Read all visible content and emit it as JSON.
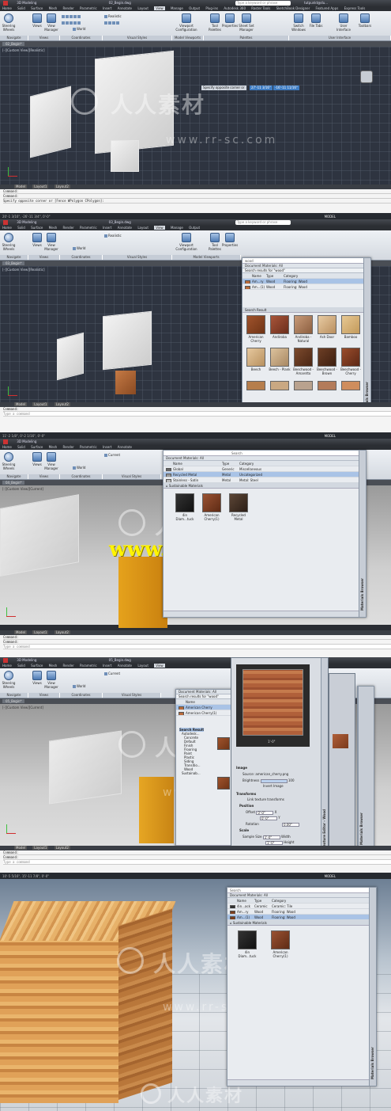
{
  "app": {
    "title_frame1": "02_Begin.dwg",
    "title_frame2": "03_Begin.dwg",
    "title_frame3": "3D Modeling",
    "title_frame4": "05_Begin.dwg",
    "workspace": "3D Modeling",
    "search_placeholder": "Type a keyword or phrase",
    "user": "tutpunkt@du...",
    "ribbon_tabs": [
      "Home",
      "Solid",
      "Surface",
      "Mesh",
      "Render",
      "Parametric",
      "Insert",
      "Annotate",
      "Layout",
      "View",
      "Manage",
      "Output",
      "Plug-ins",
      "Autodesk 360",
      "Raster Tools",
      "SketchBook Designer",
      "Featured Apps",
      "Express Tools"
    ],
    "active_tab": "View"
  },
  "ribbon": {
    "tools": [
      "Steering Wheels",
      "Views",
      "View Manager",
      "Viewport Configuration",
      "Tool Palettes",
      "Properties",
      "Sheet Set Manager",
      "Switch Windows",
      "File Tabs",
      "User Interface",
      "Toolbars"
    ],
    "visual_style": "Realistic",
    "visual_style_current": "Current",
    "ucs_world": "World",
    "groups": [
      "Navigate",
      "Views",
      "Coordinates",
      "Visual Styles",
      "Model Viewports",
      "Palettes",
      "User Interface"
    ]
  },
  "frames": [
    {
      "doc_tab": "02_Begin*",
      "viewport_label": "[-][Custom View][Realistic]",
      "tooltip": "Specify opposite corner or",
      "coord_x": "27'-11 3/16\"",
      "coord_y": "-16'-11 11/16\"",
      "layout_tabs": [
        "Model",
        "Layout1",
        "Layout2"
      ],
      "cmd_lines": [
        "Command:",
        "Command:",
        "Specify opposite corner or [Fence WPolygon CPolygon]:"
      ],
      "status_coords": "20'-1 3/16\", -26'-11 3/4\", 0'-0\"",
      "status_mode": "MODEL"
    },
    {
      "doc_tab": "03_Begin*",
      "viewport_label": "[-][Custom View][Realistic]",
      "search_value": "wood",
      "doc_materials_label": "Document Materials: All",
      "search_results_label": "Search results for \"wood\"",
      "columns": [
        "Name",
        "Type",
        "Category"
      ],
      "rows": [
        {
          "name": "Am...ry",
          "type": "Wood",
          "category": "Flooring: Wood",
          "selected": true
        },
        {
          "name": "Am...(1)",
          "type": "Wood",
          "category": "Flooring: Wood",
          "selected": false
        }
      ],
      "library": "Search Result",
      "swatches": [
        "American Cherry",
        "Andiroba",
        "Andiroba - Natural",
        "Ash Door",
        "Bamboo",
        "Beech",
        "Beech - Plank",
        "Beechwood - Amaretto",
        "Beechwood - Brown",
        "Beechwood - Cherry",
        "",
        "",
        "",
        "",
        ""
      ],
      "browser_title": "Materials Browser",
      "layout_tabs": [
        "Model",
        "Layout1",
        "Layout2"
      ],
      "cmd_lines": [
        "Command:",
        "Type a command"
      ],
      "status_coords": "11'-2 1/8\", 0'-2 1/16\", 0'-0\"",
      "status_mode": "MODEL"
    },
    {
      "doc_tab": "04_Begin*",
      "viewport_label": "[-][Custom View][Current]",
      "search_value": "Search",
      "doc_materials_label": "Document Materials: All",
      "columns": [
        "Name",
        "Type",
        "Category"
      ],
      "rows": [
        {
          "name": "Global",
          "type": "Generic",
          "category": "Miscellaneous",
          "selected": false
        },
        {
          "name": "Recycled Metal",
          "type": "Metal",
          "category": "Uncategorized",
          "selected": true
        },
        {
          "name": "Stainless - Satin",
          "type": "Metal",
          "category": "Metal: Steel",
          "selected": false
        }
      ],
      "library": "Sustainable Materials",
      "swatches": [
        "4in Diam...tuck",
        "American Cherry(1)",
        "Recycled Metal"
      ],
      "browser_title": "Materials Browser",
      "overlay_text": "www.cg-ku.com",
      "layout_tabs": [
        "Model",
        "Layout1",
        "Layout2"
      ],
      "cmd_lines": [
        "Command:",
        "Command:",
        "Type a command"
      ],
      "status_mode": "MODEL"
    },
    {
      "doc_tab": "05_Begin*",
      "viewport_label": "[-][Custom View][Current]",
      "doc_materials_label": "Document Materials: All",
      "search_results_label": "Search results for \"wood\"",
      "columns": [
        "Name"
      ],
      "rows": [
        {
          "name": "American Cherry",
          "selected": true
        },
        {
          "name": "American Cherry(1)",
          "selected": false
        }
      ],
      "tree": [
        "Search Result",
        "Autodesk...",
        "Concrete",
        "Default",
        "Finish",
        "Flooring",
        "Paint",
        "Plastic",
        "Siding",
        "Transitio...",
        "Wood",
        "Sustainab..."
      ],
      "texture_editor": {
        "title": "Texture Editor - Wood",
        "preview_size": "1'-0\"",
        "section_image": "Image",
        "source_label": "Source",
        "source_value": "american_cherry.png",
        "brightness_label": "Brightness",
        "brightness_value": "100",
        "invert_label": "Invert Image",
        "section_transforms": "Transforms",
        "link_label": "Link texture transforms",
        "section_position": "Position",
        "offset_label": "Offset",
        "offset_x": "0'-0\"",
        "offset_y": "0'-0\"",
        "x_label": "X",
        "y_label": "Y",
        "rotation_label": "Rotation",
        "rotation_value": "0.00°",
        "section_scale": "Scale",
        "sample_label": "Sample Size",
        "width_label": "Width",
        "height_label": "Height",
        "width_value": "1'-0\"",
        "height_value": "1'-0\""
      },
      "browser_title": "Materials Browser",
      "layout_tabs": [
        "Model",
        "Layout1",
        "Layout2"
      ],
      "cmd_lines": [
        "Command:",
        "Command:",
        "Type a command"
      ],
      "status_coords": "10'-5 5/16\", 15'-11 7/8\", 0'-0\"",
      "status_mode": "MODEL"
    },
    {
      "search_value": "Search",
      "doc_materials_label": "Document Materials: All",
      "columns": [
        "Name",
        "Type",
        "Category"
      ],
      "rows": [
        {
          "name": "4in...ack",
          "type": "Ceramic",
          "category": "Ceramic: Tile",
          "selected": false
        },
        {
          "name": "Am...ry",
          "type": "Wood",
          "category": "Flooring: Wood",
          "selected": false
        },
        {
          "name": "Am...(1)",
          "type": "Wood",
          "category": "Flooring: Wood",
          "selected": true
        }
      ],
      "library": "Sustainable Materials",
      "swatches": [
        "4in Diam...tuck",
        "American Cherry(1)"
      ],
      "browser_title": "Materials Browser"
    }
  ],
  "watermark": {
    "cn": "人人素材",
    "url": "www.rr-sc.com"
  },
  "colors": {
    "ribbon": "#e1e5eb",
    "viewport_dark": "#2e3440",
    "selection": "#a9c3e6",
    "overlay_yellow": "#fff400",
    "wood": "#b36b3c"
  }
}
